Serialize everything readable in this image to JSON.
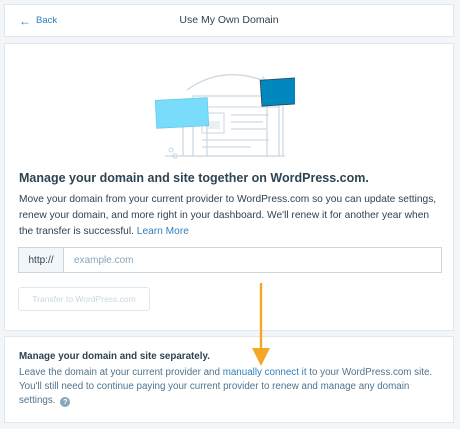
{
  "header": {
    "back_label": "Back",
    "title": "Use My Own Domain"
  },
  "main": {
    "heading": "Manage your domain and site together on WordPress.com.",
    "description": "Move your domain from your current provider to WordPress.com so you can update settings, renew your domain, and more right in your dashboard. We'll renew it for another year when the transfer is successful.",
    "learn_more_label": "Learn More",
    "input_prefix": "http://",
    "input_placeholder": "example.com",
    "input_value": "",
    "transfer_button_label": "Transfer to WordPress.com"
  },
  "separate": {
    "title": "Manage your domain and site separately.",
    "text_before_link": "Leave the domain at your current provider and ",
    "link_label": "manually connect it",
    "text_after_link": " to your WordPress.com site. You'll still need to continue paying your current provider to renew and manage any domain settings.",
    "help_icon": "question-circle-icon"
  },
  "colors": {
    "accent": "#2e80c0",
    "illustration_blue": "#0087be",
    "illustration_light_blue": "#78dcfa",
    "annotation_arrow": "#f5a623"
  }
}
